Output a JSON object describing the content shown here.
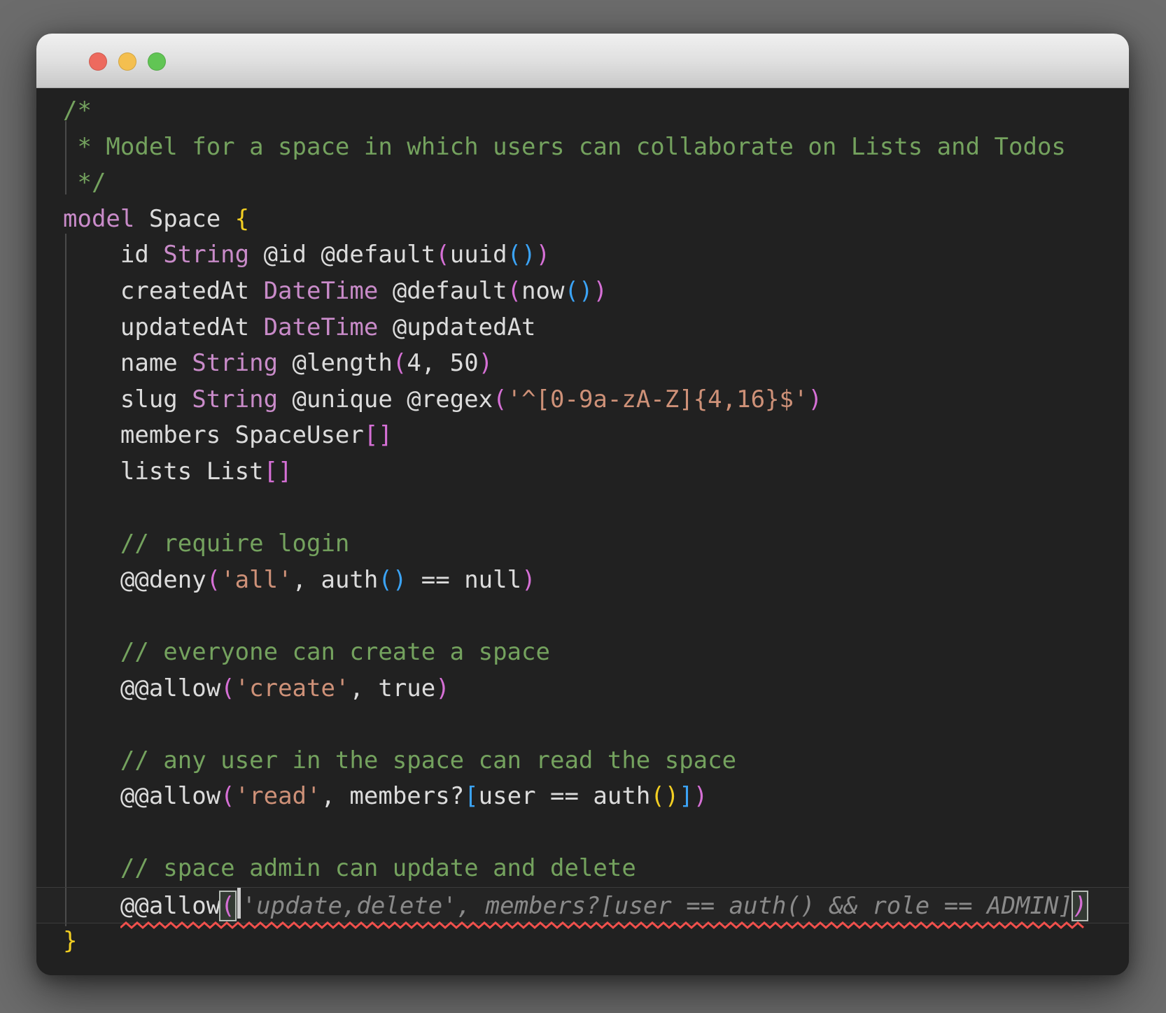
{
  "window": {
    "traffic_lights": [
      {
        "name": "close",
        "color": "#ED6A5E"
      },
      {
        "name": "minimize",
        "color": "#F4BF4F"
      },
      {
        "name": "zoom",
        "color": "#61C554"
      }
    ]
  },
  "editor": {
    "language": "zmodel",
    "colors": {
      "bg": "#212121",
      "plain": "#DCDCDC",
      "comment": "#74A25E",
      "keyword": "#C98BC9",
      "string": "#CE9178",
      "b1": "#F2CE22",
      "b2": "#D670D6",
      "b3": "#3BA3F5",
      "ghost": "#8A8A8A",
      "error": "#F0504C",
      "guide": "#4A4A4A",
      "matchbox": "#B6BCB6",
      "currentline": "#3C3C3C",
      "cursor": "#CCCCCC"
    },
    "lines": [
      {
        "tokens": [
          {
            "t": "/*",
            "s": "comment"
          }
        ]
      },
      {
        "tokens": [
          {
            "t": " * Model for a space in which users can collaborate on Lists and Todos",
            "s": "comment"
          }
        ]
      },
      {
        "tokens": [
          {
            "t": " */",
            "s": "comment"
          }
        ]
      },
      {
        "tokens": [
          {
            "t": "model",
            "s": "keyword"
          },
          {
            "t": " Space ",
            "s": "plain"
          },
          {
            "t": "{",
            "s": "b1"
          }
        ]
      },
      {
        "tokens": [
          {
            "t": "    id ",
            "s": "plain"
          },
          {
            "t": "String",
            "s": "keyword"
          },
          {
            "t": " @id @default",
            "s": "plain"
          },
          {
            "t": "(",
            "s": "b2"
          },
          {
            "t": "uuid",
            "s": "plain"
          },
          {
            "t": "()",
            "s": "b3"
          },
          {
            "t": ")",
            "s": "b2"
          }
        ]
      },
      {
        "tokens": [
          {
            "t": "    createdAt ",
            "s": "plain"
          },
          {
            "t": "DateTime",
            "s": "keyword"
          },
          {
            "t": " @default",
            "s": "plain"
          },
          {
            "t": "(",
            "s": "b2"
          },
          {
            "t": "now",
            "s": "plain"
          },
          {
            "t": "()",
            "s": "b3"
          },
          {
            "t": ")",
            "s": "b2"
          }
        ]
      },
      {
        "tokens": [
          {
            "t": "    updatedAt ",
            "s": "plain"
          },
          {
            "t": "DateTime",
            "s": "keyword"
          },
          {
            "t": " @updatedAt",
            "s": "plain"
          }
        ]
      },
      {
        "tokens": [
          {
            "t": "    name ",
            "s": "plain"
          },
          {
            "t": "String",
            "s": "keyword"
          },
          {
            "t": " @length",
            "s": "plain"
          },
          {
            "t": "(",
            "s": "b2"
          },
          {
            "t": "4, 50",
            "s": "plain"
          },
          {
            "t": ")",
            "s": "b2"
          }
        ]
      },
      {
        "tokens": [
          {
            "t": "    slug ",
            "s": "plain"
          },
          {
            "t": "String",
            "s": "keyword"
          },
          {
            "t": " @unique @regex",
            "s": "plain"
          },
          {
            "t": "(",
            "s": "b2"
          },
          {
            "t": "'^[0-9a-zA-Z]{4,16}$'",
            "s": "string"
          },
          {
            "t": ")",
            "s": "b2"
          }
        ]
      },
      {
        "tokens": [
          {
            "t": "    members SpaceUser",
            "s": "plain"
          },
          {
            "t": "[]",
            "s": "b2"
          }
        ]
      },
      {
        "tokens": [
          {
            "t": "    lists List",
            "s": "plain"
          },
          {
            "t": "[]",
            "s": "b2"
          }
        ]
      },
      {
        "tokens": []
      },
      {
        "tokens": [
          {
            "t": "    // require login",
            "s": "comment"
          }
        ]
      },
      {
        "tokens": [
          {
            "t": "    @@deny",
            "s": "plain"
          },
          {
            "t": "(",
            "s": "b2"
          },
          {
            "t": "'all'",
            "s": "string"
          },
          {
            "t": ", auth",
            "s": "plain"
          },
          {
            "t": "()",
            "s": "b3"
          },
          {
            "t": " == null",
            "s": "plain"
          },
          {
            "t": ")",
            "s": "b2"
          }
        ]
      },
      {
        "tokens": []
      },
      {
        "tokens": [
          {
            "t": "    // everyone can create a space",
            "s": "comment"
          }
        ]
      },
      {
        "tokens": [
          {
            "t": "    @@allow",
            "s": "plain"
          },
          {
            "t": "(",
            "s": "b2"
          },
          {
            "t": "'create'",
            "s": "string"
          },
          {
            "t": ", true",
            "s": "plain"
          },
          {
            "t": ")",
            "s": "b2"
          }
        ]
      },
      {
        "tokens": []
      },
      {
        "tokens": [
          {
            "t": "    // any user in the space can read the space",
            "s": "comment"
          }
        ]
      },
      {
        "tokens": [
          {
            "t": "    @@allow",
            "s": "plain"
          },
          {
            "t": "(",
            "s": "b2"
          },
          {
            "t": "'read'",
            "s": "string"
          },
          {
            "t": ", members?",
            "s": "plain"
          },
          {
            "t": "[",
            "s": "b3"
          },
          {
            "t": "user == auth",
            "s": "plain"
          },
          {
            "t": "()",
            "s": "b1"
          },
          {
            "t": "]",
            "s": "b3"
          },
          {
            "t": ")",
            "s": "b2"
          }
        ]
      },
      {
        "tokens": []
      },
      {
        "tokens": [
          {
            "t": "    // space admin can update and delete",
            "s": "comment"
          }
        ]
      },
      {
        "current": true,
        "error": true,
        "error_from": 1,
        "tokens": [
          {
            "t": "    ",
            "s": "plain"
          },
          {
            "t": "@@allow",
            "s": "plain"
          },
          {
            "t": "(",
            "s": "b2 box"
          },
          {
            "cursor": true
          },
          {
            "t": "'update,delete', members?[user == auth() && role == ADMIN]",
            "s": "ghost"
          },
          {
            "t": ")",
            "s": "b2 italic box"
          }
        ]
      },
      {
        "tokens": [
          {
            "t": "}",
            "s": "b1"
          }
        ]
      }
    ]
  }
}
